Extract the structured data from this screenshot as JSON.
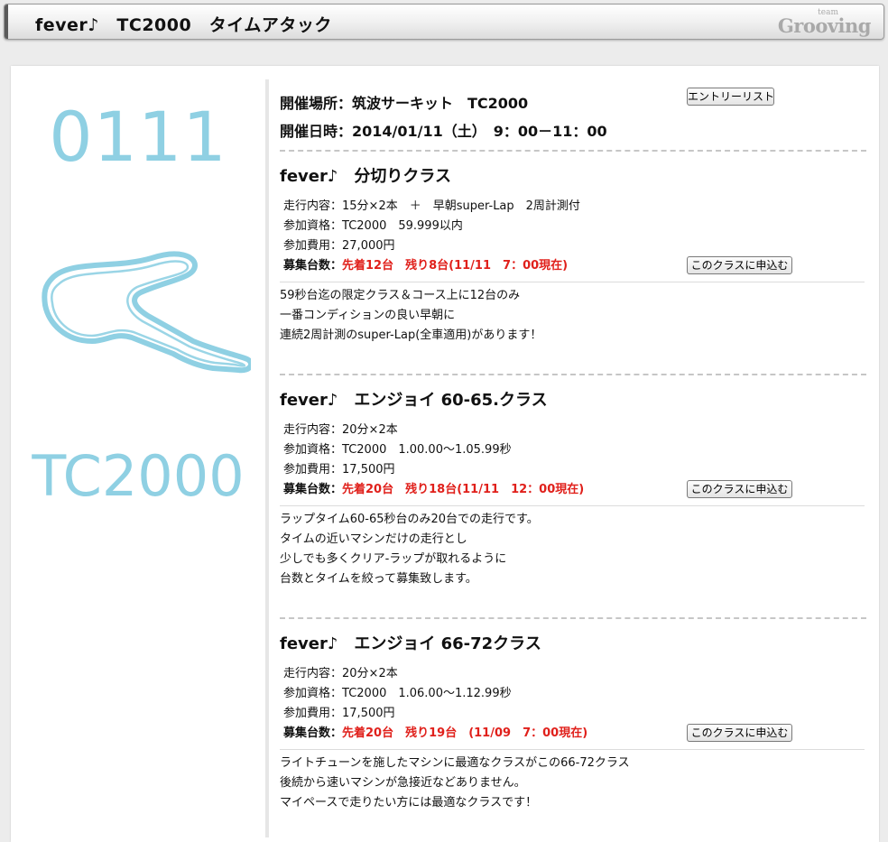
{
  "header": {
    "title": "fever♪　TC2000　タイムアタック",
    "logo_small": "team",
    "logo_big": "Grooving"
  },
  "event": {
    "code": "0111",
    "track_name": "TC2000",
    "venue": "開催場所：筑波サーキット　TC2000",
    "datetime": "開催日時：2014/01/11（土）　9：00－11：00",
    "entry_list_label": "エントリーリスト",
    "accent_color": "#8fd0e3"
  },
  "classes": [
    {
      "title": "fever♪　分切りクラス",
      "run_label": "走行内容：",
      "run_value": "15分×2本　＋　早朝super-Lap　2周計測付",
      "qual_label": "参加資格：",
      "qual_value": "TC2000　59.999以内",
      "fee_label": "参加費用：",
      "fee_value": "27,000円",
      "slots_label": "募集台数：",
      "slots_value": "先着12台　残り8台(11/11　7：00現在)",
      "apply_label": "このクラスに申込む",
      "desc": [
        "59秒台迄の限定クラス＆コース上に12台のみ",
        "一番コンディションの良い早朝に",
        "連続2周計測のsuper-Lap(全車適用)があります！"
      ]
    },
    {
      "title": "fever♪　エンジョイ 60-65.クラス",
      "run_label": "走行内容：",
      "run_value": "20分×2本",
      "qual_label": "参加資格：",
      "qual_value": "TC2000　1.00.00～1.05.99秒",
      "fee_label": "参加費用：",
      "fee_value": "17,500円",
      "slots_label": "募集台数：",
      "slots_value": "先着20台　残り18台(11/11　12：00現在)",
      "apply_label": "このクラスに申込む",
      "desc": [
        "ラップタイム60-65秒台のみ20台での走行です。",
        "タイムの近いマシンだけの走行とし",
        "少しでも多くクリア-ラップが取れるように",
        "台数とタイムを絞って募集致します。"
      ]
    },
    {
      "title": "fever♪　エンジョイ 66-72クラス",
      "run_label": "走行内容：",
      "run_value": "20分×2本",
      "qual_label": "参加資格：",
      "qual_value": "TC2000　1.06.00～1.12.99秒",
      "fee_label": "参加費用：",
      "fee_value": "17,500円",
      "slots_label": "募集台数：",
      "slots_value": "先着20台　残り19台　(11/09　7：00現在)",
      "apply_label": "このクラスに申込む",
      "desc": [
        "ライトチューンを施したマシンに最適なクラスがこの66-72クラス",
        "後続から速いマシンが急接近などありません。",
        "マイペースで走りたい方には最適なクラスです！"
      ]
    }
  ]
}
